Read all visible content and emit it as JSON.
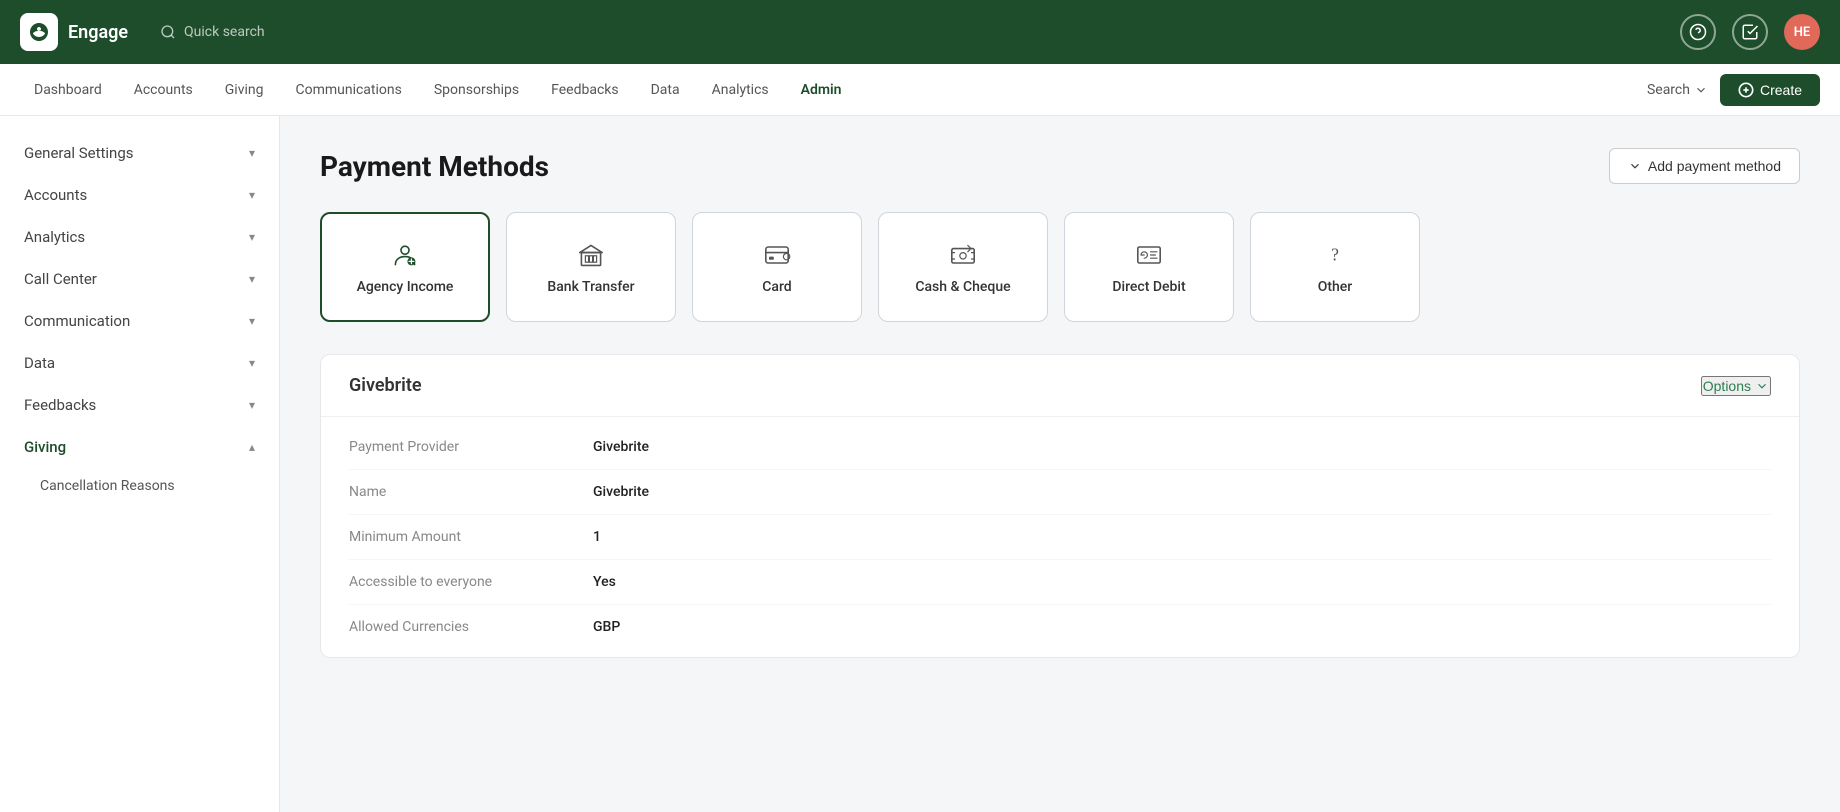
{
  "app": {
    "name": "Engage",
    "logo_alt": "engage-logo"
  },
  "topbar": {
    "search_placeholder": "Quick search",
    "user_initials": "HE",
    "user_bg": "#e0695a"
  },
  "secondary_nav": {
    "items": [
      {
        "label": "Dashboard",
        "active": false
      },
      {
        "label": "Accounts",
        "active": false
      },
      {
        "label": "Giving",
        "active": false
      },
      {
        "label": "Communications",
        "active": false
      },
      {
        "label": "Sponsorships",
        "active": false
      },
      {
        "label": "Feedbacks",
        "active": false
      },
      {
        "label": "Data",
        "active": false
      },
      {
        "label": "Analytics",
        "active": false
      },
      {
        "label": "Admin",
        "active": true
      }
    ],
    "search_label": "Search",
    "create_label": "Create"
  },
  "sidebar": {
    "items": [
      {
        "label": "General Settings",
        "expanded": false,
        "chevron": "▾"
      },
      {
        "label": "Accounts",
        "expanded": false,
        "chevron": "▾"
      },
      {
        "label": "Analytics",
        "expanded": false,
        "chevron": "▾"
      },
      {
        "label": "Call Center",
        "expanded": false,
        "chevron": "▾"
      },
      {
        "label": "Communication",
        "expanded": false,
        "chevron": "▾"
      },
      {
        "label": "Data",
        "expanded": false,
        "chevron": "▾"
      },
      {
        "label": "Feedbacks",
        "expanded": false,
        "chevron": "▾"
      },
      {
        "label": "Giving",
        "expanded": true,
        "chevron": "▴"
      }
    ],
    "sub_items": [
      {
        "label": "Cancellation Reasons"
      }
    ]
  },
  "page": {
    "title": "Payment Methods",
    "add_button": "Add payment method"
  },
  "payment_methods": [
    {
      "id": "agency-income",
      "label": "Agency Income",
      "icon": "agency",
      "active": true
    },
    {
      "id": "bank-transfer",
      "label": "Bank Transfer",
      "icon": "bank",
      "active": false
    },
    {
      "id": "card",
      "label": "Card",
      "icon": "card",
      "active": false
    },
    {
      "id": "cash-cheque",
      "label": "Cash & Cheque",
      "icon": "cash",
      "active": false
    },
    {
      "id": "direct-debit",
      "label": "Direct Debit",
      "icon": "direct-debit",
      "active": false
    },
    {
      "id": "other",
      "label": "Other",
      "icon": "other",
      "active": false
    }
  ],
  "details": {
    "title": "Givebrite",
    "options_label": "Options",
    "fields": [
      {
        "label": "Payment Provider",
        "value": "Givebrite"
      },
      {
        "label": "Name",
        "value": "Givebrite"
      },
      {
        "label": "Minimum Amount",
        "value": "1"
      },
      {
        "label": "Accessible to everyone",
        "value": "Yes"
      },
      {
        "label": "Allowed Currencies",
        "value": "GBP"
      }
    ]
  }
}
